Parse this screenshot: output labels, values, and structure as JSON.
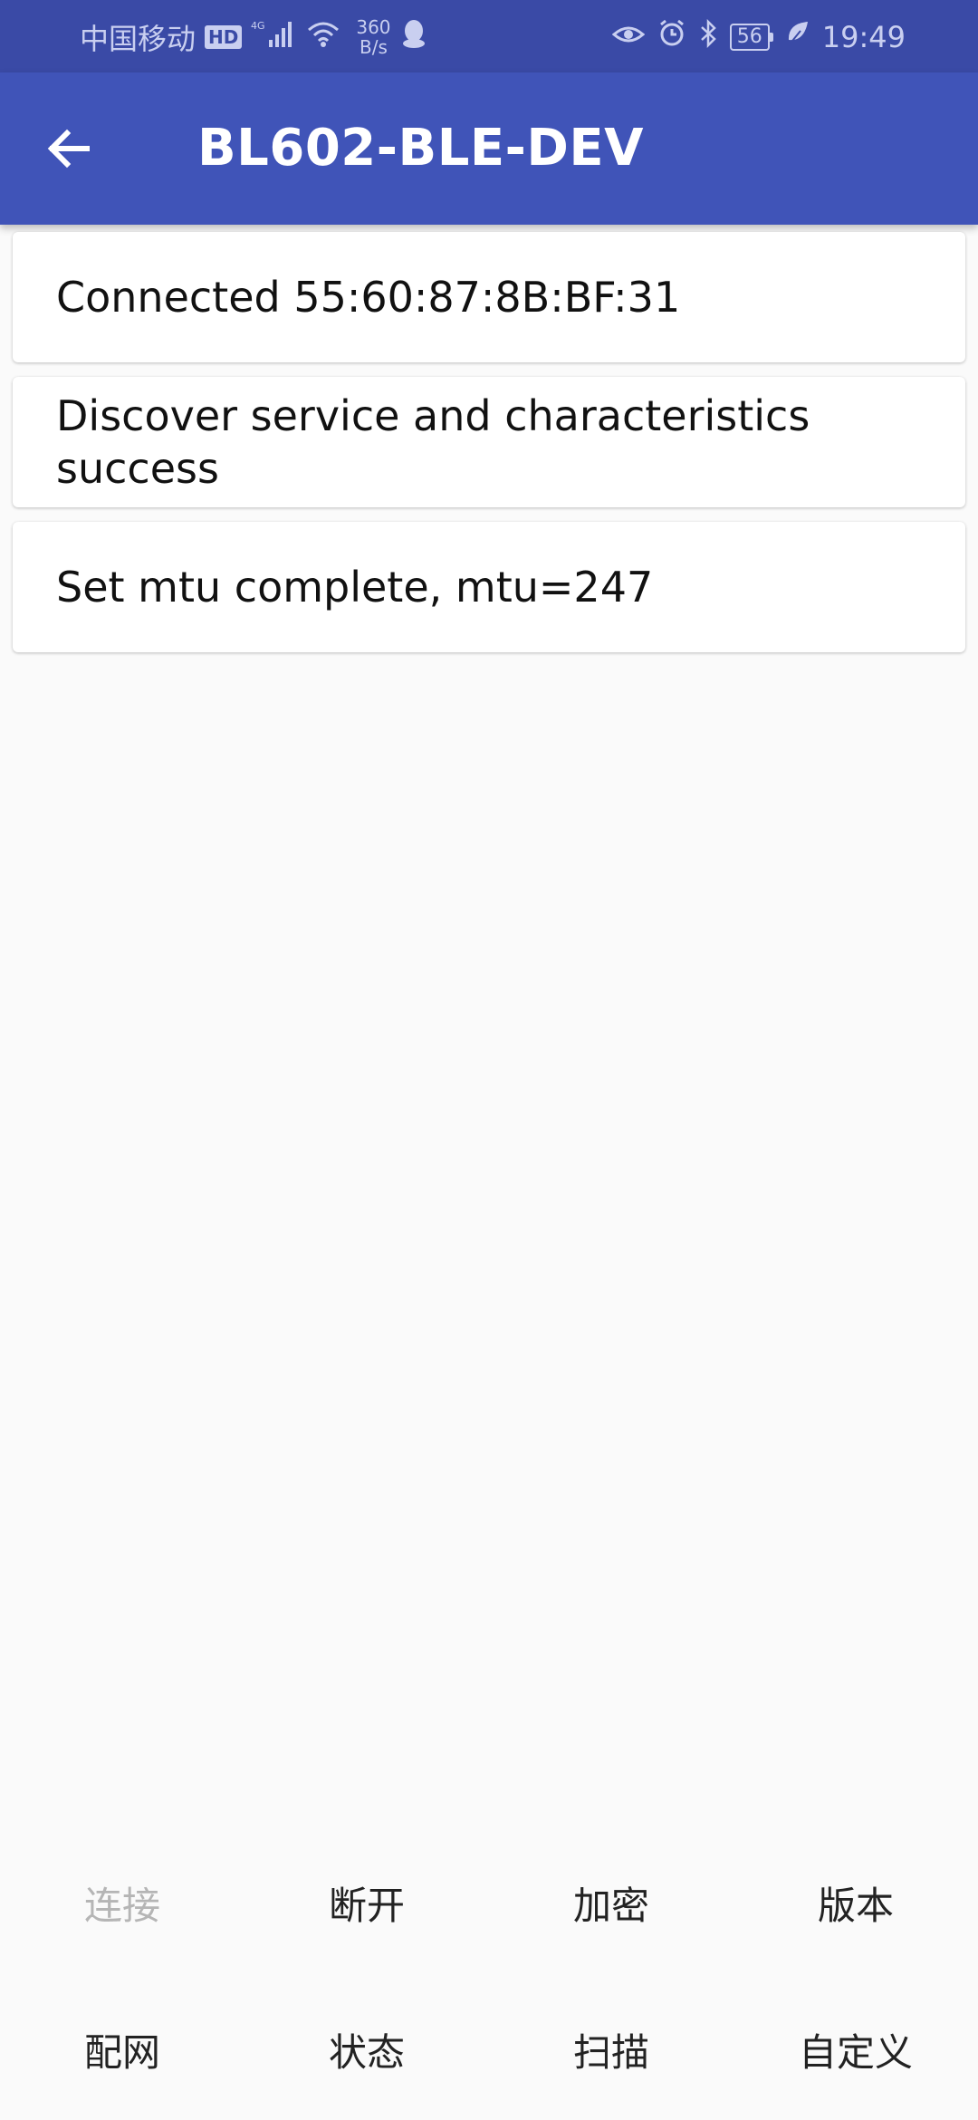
{
  "status_bar": {
    "carrier": "中国移动",
    "hd_badge": "HD",
    "network_type": "4G",
    "net_speed_value": "360",
    "net_speed_unit": "B/s",
    "battery": "56",
    "time": "19:49"
  },
  "toolbar": {
    "title": "BL602-BLE-DEV"
  },
  "log": {
    "items": [
      "Connected 55:60:87:8B:BF:31",
      "Discover service and characteristics success",
      "Set mtu complete, mtu=247"
    ]
  },
  "buttons": {
    "row1": [
      "连接",
      "断开",
      "加密",
      "版本"
    ],
    "row2": [
      "配网",
      "状态",
      "扫描",
      "自定义"
    ]
  },
  "colors": {
    "status_bar": "#3a4aa6",
    "toolbar": "#4054b8",
    "background": "#fafafa",
    "disabled_text": "#b5b5b5"
  }
}
